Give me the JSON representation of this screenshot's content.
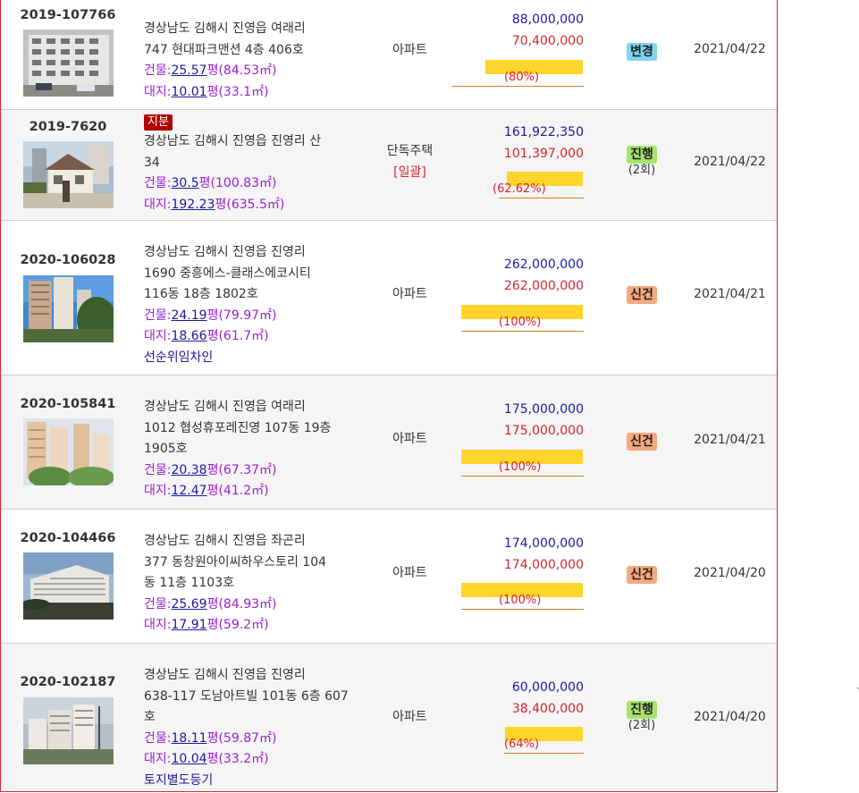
{
  "rows": [
    {
      "case": "2019-107766",
      "share": "",
      "addr1": "경상남도 김해시 진영읍 여래리",
      "addr2": "747 현대파크맨션 4층 406호",
      "addr3": "",
      "bldg_label": "건물:",
      "bldg_py": "25.57",
      "bldg_unit": "평",
      "bldg_m2": "(84.53㎡)",
      "land_label": "대지:",
      "land_py": "10.01",
      "land_unit": "평",
      "land_m2": "(33.1㎡)",
      "note": "",
      "type": "아파트",
      "type_sub": "",
      "appraisal": "88,000,000",
      "minimum": "70,400,000",
      "ratio": "(80%)",
      "ratio_value": 0.8,
      "status": "변경",
      "status_sub": "",
      "date": "2021/04/22"
    },
    {
      "case": "2019-7620",
      "share": "지분",
      "addr1": "경상남도 김해시 진영읍 진영리 산",
      "addr2": "34",
      "addr3": "",
      "bldg_label": "건물:",
      "bldg_py": "30.5",
      "bldg_unit": "평",
      "bldg_m2": "(100.83㎡)",
      "land_label": "대지:",
      "land_py": "192.23",
      "land_unit": "평",
      "land_m2": "(635.5㎡)",
      "note": "",
      "type": "단독주택",
      "type_sub": "[일괄]",
      "appraisal": "161,922,350",
      "minimum": "101,397,000",
      "ratio": "(62.62%)",
      "ratio_value": 0.6262,
      "status": "진행",
      "status_sub": "(2회)",
      "date": "2021/04/22"
    },
    {
      "case": "2020-106028",
      "share": "",
      "addr1": "경상남도 김해시 진영읍 진영리",
      "addr2": "1690 중흥에스-클래스에코시티",
      "addr3": "116동 18층 1802호",
      "bldg_label": "건물:",
      "bldg_py": "24.19",
      "bldg_unit": "평",
      "bldg_m2": "(79.97㎡)",
      "land_label": "대지:",
      "land_py": "18.66",
      "land_unit": "평",
      "land_m2": "(61.7㎡)",
      "note": "선순위임차인",
      "type": "아파트",
      "type_sub": "",
      "appraisal": "262,000,000",
      "minimum": "262,000,000",
      "ratio": "(100%)",
      "ratio_value": 1.0,
      "status": "신건",
      "status_sub": "",
      "date": "2021/04/21"
    },
    {
      "case": "2020-105841",
      "share": "",
      "addr1": "경상남도 김해시 진영읍 여래리",
      "addr2": "1012 협성휴포레진영 107동 19층",
      "addr3": "1905호",
      "bldg_label": "건물:",
      "bldg_py": "20.38",
      "bldg_unit": "평",
      "bldg_m2": "(67.37㎡)",
      "land_label": "대지:",
      "land_py": "12.47",
      "land_unit": "평",
      "land_m2": "(41.2㎡)",
      "note": "",
      "type": "아파트",
      "type_sub": "",
      "appraisal": "175,000,000",
      "minimum": "175,000,000",
      "ratio": "(100%)",
      "ratio_value": 1.0,
      "status": "신건",
      "status_sub": "",
      "date": "2021/04/21"
    },
    {
      "case": "2020-104466",
      "share": "",
      "addr1": "경상남도 김해시 진영읍 좌곤리",
      "addr2": "377 동창원아이씨하우스토리 104",
      "addr3": "동 11층 1103호",
      "bldg_label": "건물:",
      "bldg_py": "25.69",
      "bldg_unit": "평",
      "bldg_m2": "(84.93㎡)",
      "land_label": "대지:",
      "land_py": "17.91",
      "land_unit": "평",
      "land_m2": "(59.2㎡)",
      "note": "",
      "type": "아파트",
      "type_sub": "",
      "appraisal": "174,000,000",
      "minimum": "174,000,000",
      "ratio": "(100%)",
      "ratio_value": 1.0,
      "status": "신건",
      "status_sub": "",
      "date": "2021/04/20"
    },
    {
      "case": "2020-102187",
      "share": "",
      "addr1": "경상남도 김해시 진영읍 진영리",
      "addr2": "638-117 도남아트빌 101동 6층 607",
      "addr3": "호",
      "bldg_label": "건물:",
      "bldg_py": "18.11",
      "bldg_unit": "평",
      "bldg_m2": "(59.87㎡)",
      "land_label": "대지:",
      "land_py": "10.04",
      "land_unit": "평",
      "land_m2": "(33.2㎡)",
      "note": "토지별도등기",
      "type": "아파트",
      "type_sub": "",
      "appraisal": "60,000,000",
      "minimum": "38,400,000",
      "ratio": "(64%)",
      "ratio_value": 0.64,
      "status": "진행",
      "status_sub": "(2회)",
      "date": "2021/04/20"
    }
  ],
  "stray_mark": "·"
}
